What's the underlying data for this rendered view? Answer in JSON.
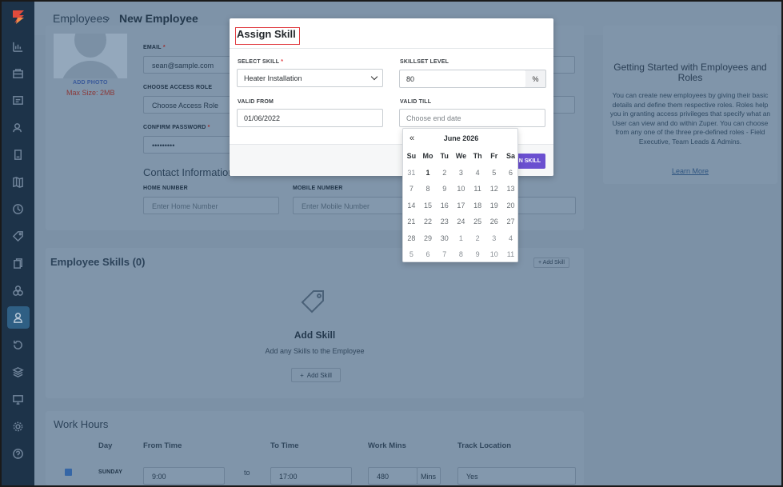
{
  "header": {
    "breadcrumb_root": "Employees",
    "breadcrumb_sep": "›",
    "page_title": "New Employee"
  },
  "profile": {
    "add_photo": "ADD PHOTO",
    "max_size": "Max Size: 2MB"
  },
  "form": {
    "email_label": "EMAIL",
    "email_value": "sean@sample.com",
    "access_role_label": "CHOOSE ACCESS ROLE",
    "access_role_value": "Choose Access Role",
    "confirm_password_label": "CONFIRM PASSWORD",
    "confirm_password_value": "•••••••••",
    "contact_title": "Contact Information",
    "home_number_label": "HOME NUMBER",
    "home_number_placeholder": "Enter Home Number",
    "mobile_number_label": "MOBILE NUMBER",
    "mobile_number_placeholder": "Enter Mobile Number"
  },
  "getting_started": {
    "title": "Getting Started with Employees and Roles",
    "body": "You can create new employees by giving their basic details and define them respective roles. Roles help you in granting access privileges that specify what an User can view and do within Zuper. You can choose from any one of the three pre-defined roles - Field Executive, Team Leads & Admins.",
    "link": "Learn More"
  },
  "skills": {
    "title": "Employee Skills (0)",
    "add_button": "+ Add Skill",
    "empty_title": "Add Skill",
    "empty_desc": "Add any Skills to the Employee",
    "empty_button": "Add Skill"
  },
  "work_hours": {
    "title": "Work Hours",
    "columns": [
      "Day",
      "From Time",
      "To Time",
      "Work Mins",
      "Track Location"
    ],
    "row": {
      "day": "SUNDAY",
      "from": "9:00",
      "to_sep": "to",
      "to": "17:00",
      "mins": "480",
      "mins_unit": "Mins",
      "track": "Yes"
    }
  },
  "modal": {
    "title": "Assign Skill",
    "select_skill_label": "SELECT SKILL",
    "select_skill_value": "Heater Installation",
    "skillset_level_label": "SKILLSET LEVEL",
    "skillset_level_value": "80",
    "skillset_level_unit": "%",
    "valid_from_label": "VALID FROM",
    "valid_from_value": "01/06/2022",
    "valid_till_label": "VALID TILL",
    "valid_till_placeholder": "Choose end date",
    "assign_button": "N SKILL"
  },
  "datepicker": {
    "prev": "«",
    "month": "June 2026",
    "weekdays": [
      "Su",
      "Mo",
      "Tu",
      "We",
      "Th",
      "Fr",
      "Sa"
    ],
    "weeks": [
      [
        "31",
        "1",
        "2",
        "3",
        "4",
        "5",
        "6"
      ],
      [
        "7",
        "8",
        "9",
        "10",
        "11",
        "12",
        "13"
      ],
      [
        "14",
        "15",
        "16",
        "17",
        "18",
        "19",
        "20"
      ],
      [
        "21",
        "22",
        "23",
        "24",
        "25",
        "26",
        "27"
      ],
      [
        "28",
        "29",
        "30",
        "1",
        "2",
        "3",
        "4"
      ],
      [
        "5",
        "6",
        "7",
        "8",
        "9",
        "10",
        "11"
      ]
    ]
  },
  "colors": {
    "accent": "#6a4fd0",
    "sidebar": "#1d3349",
    "overlay": "#7e93a8",
    "required": "#e0393e"
  }
}
